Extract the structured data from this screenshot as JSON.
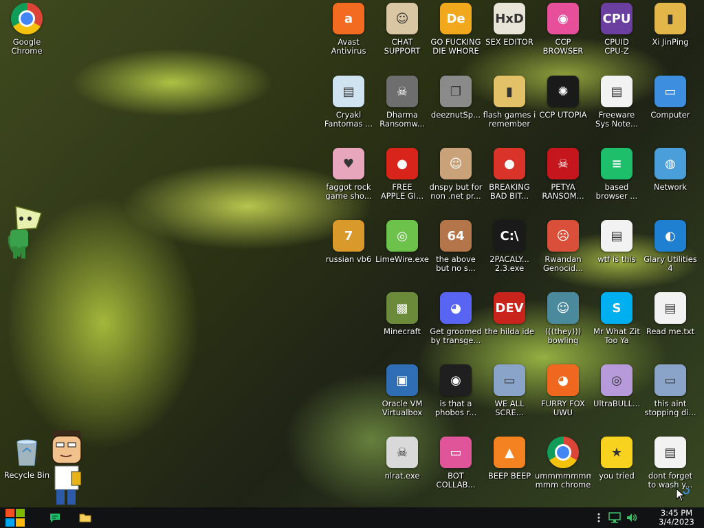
{
  "desktop": {
    "icons": [
      {
        "label": "Google\nChrome",
        "glyph": "",
        "color": "#ffffff",
        "kind": "chrome"
      },
      {
        "label": "Recycle Bin",
        "glyph": "",
        "color": "#9cc8e8",
        "kind": "bin"
      },
      {
        "label": "Avast\nAntivirus",
        "glyph": "a",
        "color": "#f26b21"
      },
      {
        "label": "CHAT\nSUPPORT",
        "glyph": "☺",
        "color": "#d9c7a3"
      },
      {
        "label": "GO FUCKING\nDIE WHORE",
        "glyph": "De",
        "color": "#f2a81d"
      },
      {
        "label": "SEX EDITOR",
        "glyph": "HxD",
        "color": "#e9e4d8"
      },
      {
        "label": "CCP\nBROWSER",
        "glyph": "◉",
        "color": "#e84f9b"
      },
      {
        "label": "CPUID\nCPU-Z",
        "glyph": "CPU",
        "color": "#6b3fa0"
      },
      {
        "label": "Xi JinPing",
        "glyph": "▮",
        "color": "#e3b64a"
      },
      {
        "label": "Cryakl\nFantomas ...",
        "glyph": "▤",
        "color": "#cfe3f0"
      },
      {
        "label": "Dharma\nRansomw...",
        "glyph": "☠",
        "color": "#6e6e6e"
      },
      {
        "label": "deeznutSp...",
        "glyph": "❐",
        "color": "#8a8a8a"
      },
      {
        "label": "flash games i\nremember",
        "glyph": "▮",
        "color": "#e3c169"
      },
      {
        "label": "CCP UTOPIA",
        "glyph": "✺",
        "color": "#1a1a1a"
      },
      {
        "label": "Freeware\nSys Note...",
        "glyph": "▤",
        "color": "#f2f2f2"
      },
      {
        "label": "Computer",
        "glyph": "▭",
        "color": "#3d8ede"
      },
      {
        "label": "faggot rock\ngame sho...",
        "glyph": "♥",
        "color": "#e8a6bd"
      },
      {
        "label": "FREE\nAPPLE GI...",
        "glyph": "●",
        "color": "#d9241c"
      },
      {
        "label": "dnspy but for\nnon .net pr...",
        "glyph": "☺",
        "color": "#c9a27a"
      },
      {
        "label": "BREAKING\nBAD BIT...",
        "glyph": "●",
        "color": "#d9332a"
      },
      {
        "label": "PETYA\nRANSOM...",
        "glyph": "☠",
        "color": "#c4161c"
      },
      {
        "label": "based\nbrowser ...",
        "glyph": "≡",
        "color": "#1dbf6a"
      },
      {
        "label": "Network",
        "glyph": "◍",
        "color": "#4a9ed9"
      },
      {
        "label": "russian vb6",
        "glyph": "7",
        "color": "#d99a2b"
      },
      {
        "label": "LimeWire.exe",
        "glyph": "◎",
        "color": "#6cc24a"
      },
      {
        "label": "the above\nbut no s...",
        "glyph": "64",
        "color": "#b5754a"
      },
      {
        "label": "2PACALY...\n2.3.exe",
        "glyph": "C:\\",
        "color": "#1a1a1a"
      },
      {
        "label": "Rwandan\nGenocid...",
        "glyph": "☹",
        "color": "#d94f3a"
      },
      {
        "label": "wtf is this",
        "glyph": "▤",
        "color": "#f2f2f2"
      },
      {
        "label": "Glary Utilities\n4",
        "glyph": "◐",
        "color": "#1f7fd1"
      },
      {
        "label": "Minecraft",
        "glyph": "▩",
        "color": "#6b8a3a"
      },
      {
        "label": "Get groomed\nby transge...",
        "glyph": "◕",
        "color": "#5865f2"
      },
      {
        "label": "the hilda ide",
        "glyph": "DEV",
        "color": "#c9241c"
      },
      {
        "label": "(((they)))\nbowling",
        "glyph": "☺",
        "color": "#4a8a9c"
      },
      {
        "label": "Mr What Zit\nToo Ya",
        "glyph": "S",
        "color": "#00aff0"
      },
      {
        "label": "Read me.txt",
        "glyph": "▤",
        "color": "#f2f2f2"
      },
      {
        "label": "Oracle VM\nVirtualbox",
        "glyph": "▣",
        "color": "#2f6db5"
      },
      {
        "label": "is that a\nphobos r...",
        "glyph": "◉",
        "color": "#1f1f1f"
      },
      {
        "label": "WE ALL\nSCRE...",
        "glyph": "▭",
        "color": "#8aa3c9"
      },
      {
        "label": "FURRY FOX\nUWU",
        "glyph": "◕",
        "color": "#f0681f"
      },
      {
        "label": "UltraBULL...",
        "glyph": "◎",
        "color": "#b79ad9"
      },
      {
        "label": "this aint\nstopping di...",
        "glyph": "▭",
        "color": "#8aa3c9"
      },
      {
        "label": "nlrat.exe",
        "glyph": "☠",
        "color": "#d9d9d9"
      },
      {
        "label": "BOT\nCOLLAB...",
        "glyph": "▭",
        "color": "#e0559a"
      },
      {
        "label": "BEEP BEEP",
        "glyph": "▲",
        "color": "#f58220"
      },
      {
        "label": "ummmmmmm\nmmm chrome",
        "glyph": "",
        "color": "#ffffff",
        "kind": "chrome"
      },
      {
        "label": "you tried",
        "glyph": "★",
        "color": "#f7d21e"
      },
      {
        "label": "dont forget\nto wash y...",
        "glyph": "▤",
        "color": "#f2f2f2"
      }
    ]
  },
  "taskbar": {
    "time": "3:45 PM",
    "date": "3/4/2023",
    "start_colors": [
      "#f25022",
      "#7fba00",
      "#00a4ef",
      "#ffb900"
    ],
    "pinned": [
      "based-browser-icon",
      "file-explorer-icon"
    ],
    "tray": [
      "network-icon",
      "volume-icon"
    ]
  }
}
